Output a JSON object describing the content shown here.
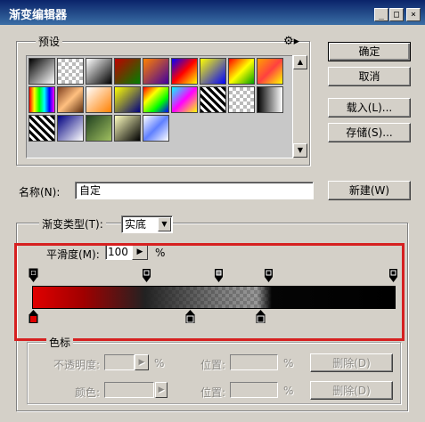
{
  "window": {
    "title": "渐变编辑器",
    "minimize": "_",
    "maximize": "□",
    "close": "×"
  },
  "buttons": {
    "ok": "确定",
    "cancel": "取消",
    "load": "载入(L)...",
    "save": "存储(S)...",
    "new": "新建(W)"
  },
  "presets": {
    "label": "预设",
    "menu_icon": "gear-icon",
    "swatches": [
      "linear-gradient(135deg,#000,#fff)",
      "checker",
      "linear-gradient(135deg,#fff,#000)",
      "linear-gradient(135deg,#c00000,#008000)",
      "linear-gradient(135deg,#ff8000,#4000a0)",
      "linear-gradient(135deg,#0000ff,#ff0000,#ffff00)",
      "linear-gradient(135deg,#ffff00,#0000ff)",
      "linear-gradient(135deg,#ff0000,#ffff00,#00a000)",
      "linear-gradient(135deg,#ffa000,#ff4040,#ffff00)",
      "linear-gradient(90deg,#ff0000,#ffff00,#00ff00,#00ffff,#0000ff,#ff00ff)",
      "linear-gradient(135deg,#804020,#ffc080,#603010)",
      "linear-gradient(135deg,#ffffff,#ff8000)",
      "linear-gradient(135deg,#ffff00,#000080)",
      "linear-gradient(135deg,#ff0000,#ffff00,#00ff00,#0000ff)",
      "linear-gradient(135deg,#00ffff,#ff00ff,#ffff00)",
      "stripes",
      "checker",
      "linear-gradient(90deg,#000,#fff)",
      "stripes",
      "linear-gradient(135deg,#000080,#ffffff)",
      "linear-gradient(135deg,#204020,#a0c060)",
      "linear-gradient(135deg,#ffffc0,#000000)",
      "linear-gradient(135deg,#ffffff,#6080ff,#ffffff)"
    ]
  },
  "name": {
    "label": "名称(N):",
    "value": "自定"
  },
  "gradient": {
    "type_label": "渐变类型(T):",
    "type_value": "实底",
    "smooth_label": "平滑度(M):",
    "smooth_value": "100",
    "smooth_unit": "%"
  },
  "color_stop": {
    "legend": "色标",
    "opacity_label": "不透明度:",
    "opacity_unit": "%",
    "location_label": "位置:",
    "location_unit": "%",
    "delete": "删除(D)",
    "color_label": "颜色:"
  }
}
